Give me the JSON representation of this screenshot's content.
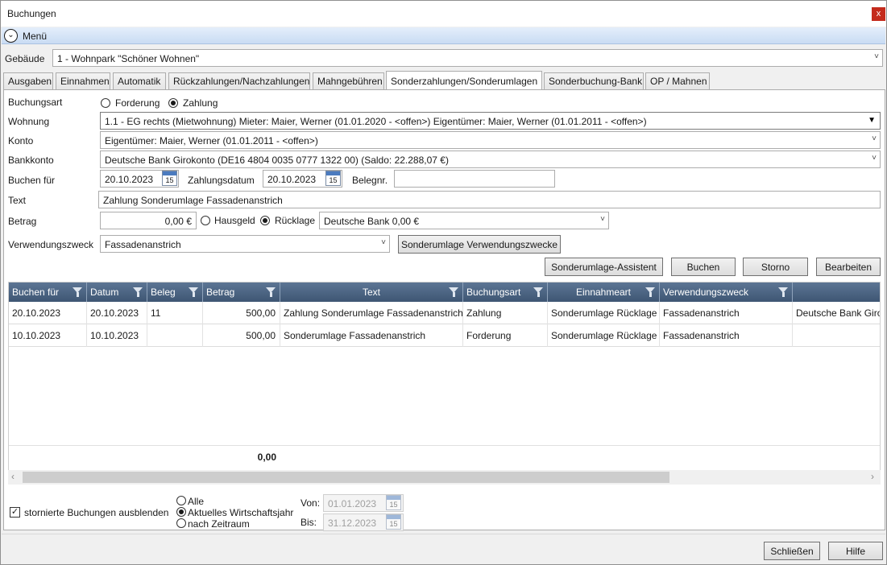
{
  "window": {
    "title": "Buchungen",
    "close_label": "x"
  },
  "menu": {
    "label": "Menü"
  },
  "building": {
    "label": "Gebäude",
    "value": "1 - Wohnpark \"Schöner Wohnen\""
  },
  "tabs": [
    {
      "label": "Ausgaben"
    },
    {
      "label": "Einnahmen"
    },
    {
      "label": "Automatik"
    },
    {
      "label": "Rückzahlungen/Nachzahlungen"
    },
    {
      "label": "Mahngebühren"
    },
    {
      "label": "Sonderzahlungen/Sonderumlagen",
      "active": true
    },
    {
      "label": "Sonderbuchung-Bank"
    },
    {
      "label": "OP / Mahnen"
    }
  ],
  "form": {
    "buchungsart": {
      "label": "Buchungsart",
      "option_forderung": "Forderung",
      "option_zahlung": "Zahlung",
      "selected": "Zahlung"
    },
    "wohnung": {
      "label": "Wohnung",
      "value": "1.1 - EG rechts (Mietwohnung)    Mieter: Maier, Werner (01.01.2020 - <offen>)    Eigentümer: Maier, Werner (01.01.2011 - <offen>)"
    },
    "konto": {
      "label": "Konto",
      "value": "Eigentümer: Maier, Werner (01.01.2011 - <offen>)"
    },
    "bankkonto": {
      "label": "Bankkonto",
      "value": "Deutsche Bank Girokonto (DE16 4804 0035 0777 1322 00) (Saldo: 22.288,07 €)"
    },
    "buchen_fuer": {
      "label": "Buchen für",
      "value": "20.10.2023"
    },
    "zahlungsdatum": {
      "label": "Zahlungsdatum",
      "value": "20.10.2023"
    },
    "belegnr": {
      "label": "Belegnr.",
      "value": ""
    },
    "text": {
      "label": "Text",
      "value": "Zahlung Sonderumlage Fassadenanstrich"
    },
    "betrag": {
      "label": "Betrag",
      "value": "0,00 €",
      "option_hausgeld": "Hausgeld",
      "option_ruecklage": "Rücklage",
      "selected": "Rücklage",
      "ruecklage_account": "Deutsche Bank 0,00 €"
    },
    "verwendungszweck": {
      "label": "Verwendungszweck",
      "value": "Fassadenanstrich",
      "button": "Sonderumlage Verwendungszwecke"
    },
    "calendar_icon_text": "15"
  },
  "actions": {
    "assistent": "Sonderumlage-Assistent",
    "buchen": "Buchen",
    "storno": "Storno",
    "bearbeiten": "Bearbeiten"
  },
  "table": {
    "columns": [
      "Buchen für",
      "Datum",
      "Beleg",
      "Betrag",
      "Text",
      "Buchungsart",
      "Einnahmeart",
      "Verwendungszweck",
      ""
    ],
    "rows": [
      [
        "20.10.2023",
        "20.10.2023",
        "11",
        "500,00",
        "Zahlung Sonderumlage Fassadenanstrich",
        "Zahlung",
        "Sonderumlage Rücklage",
        "Fassadenanstrich",
        "Deutsche Bank Girokonto"
      ],
      [
        "10.10.2023",
        "10.10.2023",
        "",
        "500,00",
        "Sonderumlage Fassadenanstrich",
        "Forderung",
        "Sonderumlage Rücklage",
        "Fassadenanstrich",
        ""
      ]
    ],
    "sum": "0,00",
    "scroll_left": "‹",
    "scroll_right": "›"
  },
  "filters": {
    "hide_storno": {
      "label": "stornierte Buchungen ausblenden",
      "checked": true
    },
    "range": {
      "option_alle": "Alle",
      "option_wj": "Aktuelles Wirtschaftsjahr",
      "option_zeitraum": "nach Zeitraum",
      "selected": "Aktuelles Wirtschaftsjahr"
    },
    "von": {
      "label": "Von:",
      "value": "01.01.2023"
    },
    "bis": {
      "label": "Bis:",
      "value": "31.12.2023"
    }
  },
  "footer": {
    "close": "Schließen",
    "help": "Hilfe"
  }
}
